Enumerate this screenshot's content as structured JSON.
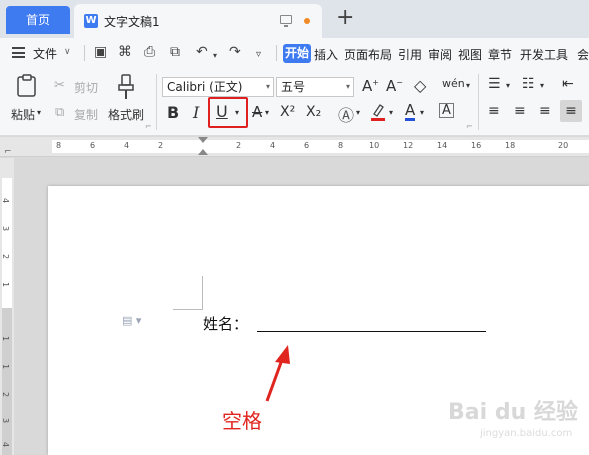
{
  "tabs": {
    "home": "首页",
    "doc_icon": "W",
    "doc_title": "文字文稿1",
    "new_tab": "+"
  },
  "menu": {
    "file": "文件",
    "start": "开始",
    "items": [
      "插入",
      "页面布局",
      "引用",
      "审阅",
      "视图",
      "章节",
      "开发工具",
      "会"
    ]
  },
  "ribbon": {
    "paste": "粘贴",
    "cut": "剪切",
    "copy": "复制",
    "format_painter": "格式刷",
    "font_name": "Calibri (正文)",
    "font_size": "五号",
    "bold": "B",
    "italic": "I",
    "underline": "U",
    "strike": "A",
    "superscript": "X²",
    "subscript": "X₂",
    "font_color": "A",
    "char_border": "A",
    "phonetic": "wén"
  },
  "ruler": {
    "h_ticks": [
      "8",
      "6",
      "4",
      "2",
      "2",
      "4",
      "6",
      "8",
      "10",
      "12",
      "14",
      "16",
      "18",
      "20"
    ],
    "v_ticks": [
      "4",
      "3",
      "2",
      "1",
      "1",
      "1",
      "2",
      "3",
      "4"
    ]
  },
  "document": {
    "label": "姓名：",
    "annotation": "空格"
  },
  "watermark": {
    "brand": "Bai du 经验",
    "url": "jingyan.baidu.com"
  },
  "colors": {
    "accent": "#3e7bf0",
    "highlight_box": "#e02020",
    "annotation": "#e0251f"
  }
}
